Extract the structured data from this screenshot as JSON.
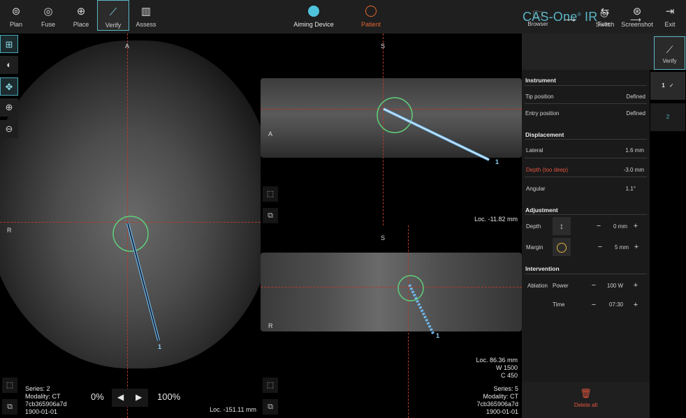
{
  "toolbar": {
    "items": [
      {
        "label": "Plan",
        "icon": "plan-icon"
      },
      {
        "label": "Fuse",
        "icon": "fuse-icon"
      },
      {
        "label": "Place",
        "icon": "place-icon"
      },
      {
        "label": "Verify",
        "icon": "verify-icon"
      },
      {
        "label": "Assess",
        "icon": "assess-icon"
      }
    ],
    "aiming_label": "Aiming Device",
    "patient_label": "Patient",
    "brand_main": "CAS-One",
    "brand_sup": "®",
    "brand_suffix": " IR",
    "switch_label": "Switch",
    "screenshot_label": "Screenshot",
    "exit_label": "Exit"
  },
  "colors": {
    "accent": "#58b6c6",
    "aiming": "#4fc3dc",
    "patient": "#e0662f",
    "crosshair": "#b13b2c",
    "warning": "#e2553f",
    "target_circle": "#5fd07a",
    "needle": "#6fb6ea"
  },
  "views": {
    "axial": {
      "top": "A",
      "left": "R",
      "needle_label": "1",
      "loc": "Loc. -151.11 mm"
    },
    "sagittal": {
      "top": "S",
      "left": "A",
      "needle_label": "1",
      "loc": "Loc. -11.82 mm"
    },
    "coronal": {
      "top": "S",
      "left": "R",
      "needle_label": "1",
      "loc": "Loc. 86.36 mm",
      "w": "W 1500",
      "c": "C 450"
    }
  },
  "series_left": {
    "series": "Series: 2",
    "modality": "Modality: CT",
    "id": "7cb365906a7d",
    "date": "1900-01-01"
  },
  "series_right": {
    "series": "Series: 5",
    "modality": "Modality: CT",
    "id": "7cb365906a7d",
    "date": "1900-01-01"
  },
  "pager": {
    "left_pct": "0%",
    "right_pct": "100%"
  },
  "workflow": {
    "browser": "Browser",
    "fuse": "Fuse",
    "verify": "Verify"
  },
  "instrument": {
    "title": "Instrument",
    "tip_label": "Tip position",
    "tip_value": "Defined",
    "entry_label": "Entry position",
    "entry_value": "Defined"
  },
  "displacement": {
    "title": "Displacement",
    "lateral_label": "Lateral",
    "lateral_value": "1.6 mm",
    "depth_label": "Depth (too deep)",
    "depth_value": "-3.0 mm",
    "angular_label": "Angular",
    "angular_value": "1.1°"
  },
  "adjustment": {
    "title": "Adjustment",
    "depth_label": "Depth",
    "depth_value": "0 mm",
    "margin_label": "Margin",
    "margin_value": "5 mm"
  },
  "intervention": {
    "title": "Intervention",
    "ablation_label": "Ablation",
    "power_label": "Power",
    "power_value": "100 W",
    "time_label": "Time",
    "time_value": "07:30"
  },
  "slots": [
    {
      "label": "1",
      "check": "✓"
    },
    {
      "label": "2"
    }
  ],
  "delete_label": "Delete all"
}
